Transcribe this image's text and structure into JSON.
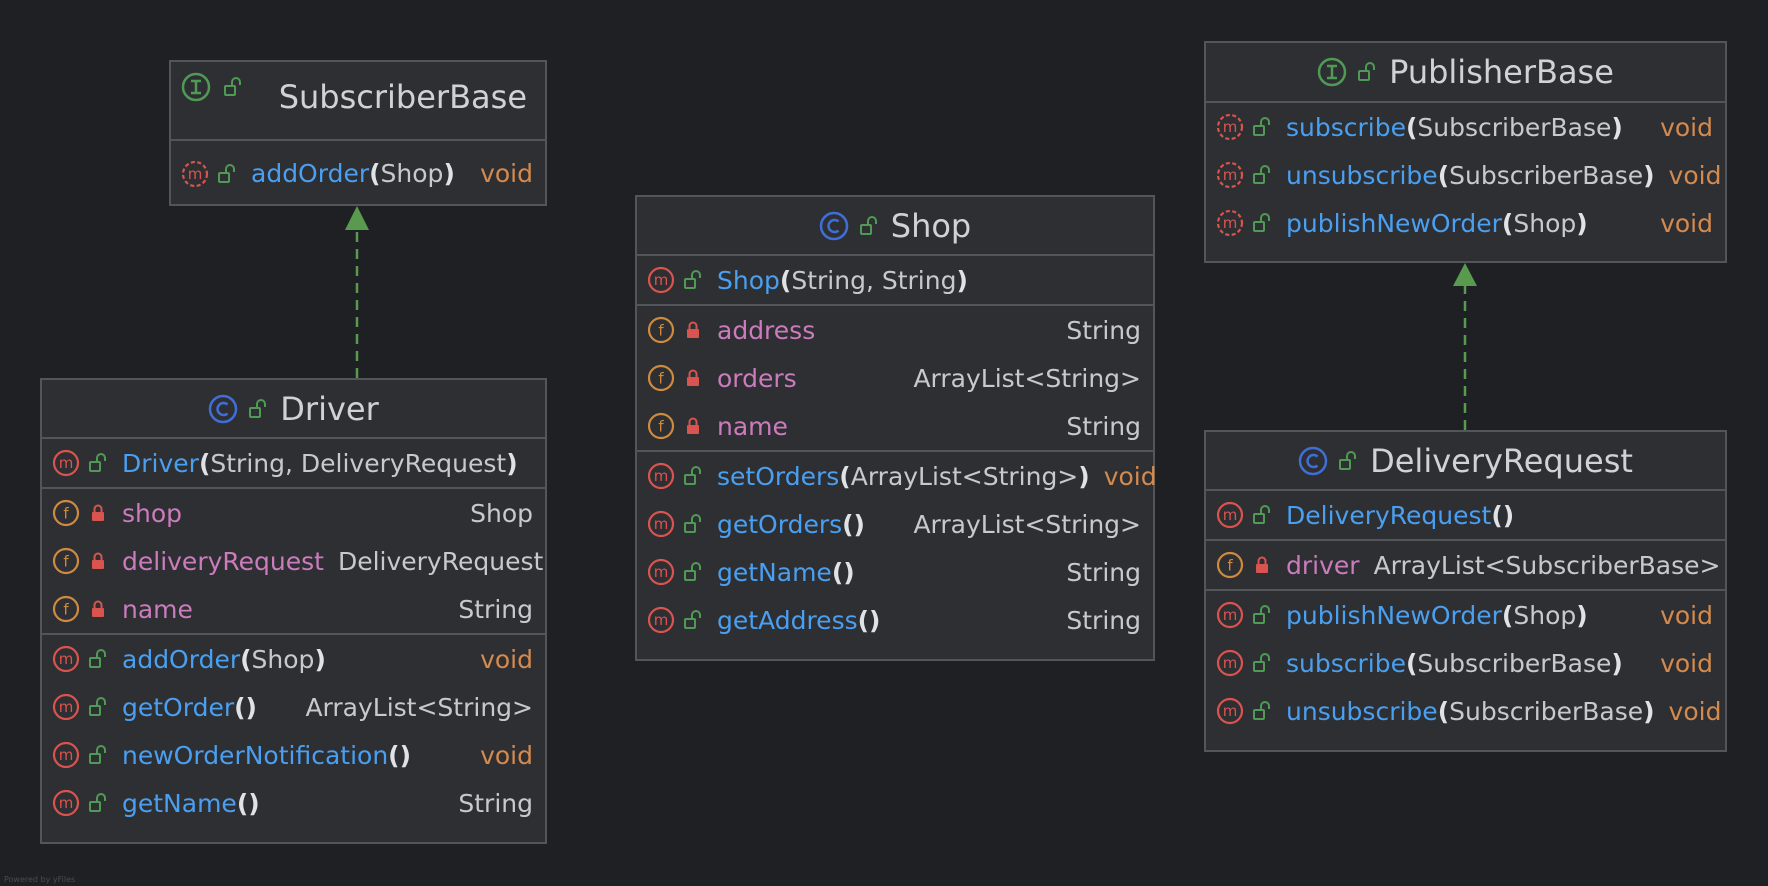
{
  "diagram": {
    "footer": "Powered by yFiles",
    "classes": {
      "subscriber_base": {
        "name": "SubscriberBase",
        "kind": "interface",
        "methods": [
          {
            "name": "addOrder",
            "params": "Shop",
            "ret": "void",
            "abstract": true
          }
        ]
      },
      "publisher_base": {
        "name": "PublisherBase",
        "kind": "interface",
        "methods": [
          {
            "name": "subscribe",
            "params": "SubscriberBase",
            "ret": "void",
            "abstract": true
          },
          {
            "name": "unsubscribe",
            "params": "SubscriberBase",
            "ret": "void",
            "abstract": true
          },
          {
            "name": "publishNewOrder",
            "params": "Shop",
            "ret": "void",
            "abstract": true
          }
        ]
      },
      "shop": {
        "name": "Shop",
        "kind": "class",
        "constructor": {
          "name": "Shop",
          "params": "String, String"
        },
        "fields": [
          {
            "name": "address",
            "type": "String"
          },
          {
            "name": "orders",
            "type": "ArrayList<String>"
          },
          {
            "name": "name",
            "type": "String"
          }
        ],
        "methods": [
          {
            "name": "setOrders",
            "params": "ArrayList<String>",
            "ret": "void"
          },
          {
            "name": "getOrders",
            "params": "",
            "ret": "ArrayList<String>"
          },
          {
            "name": "getName",
            "params": "",
            "ret": "String"
          },
          {
            "name": "getAddress",
            "params": "",
            "ret": "String"
          }
        ]
      },
      "driver": {
        "name": "Driver",
        "kind": "class",
        "constructor": {
          "name": "Driver",
          "params": "String, DeliveryRequest"
        },
        "fields": [
          {
            "name": "shop",
            "type": "Shop"
          },
          {
            "name": "deliveryRequest",
            "type": "DeliveryRequest"
          },
          {
            "name": "name",
            "type": "String"
          }
        ],
        "methods": [
          {
            "name": "addOrder",
            "params": "Shop",
            "ret": "void"
          },
          {
            "name": "getOrder",
            "params": "",
            "ret": "ArrayList<String>"
          },
          {
            "name": "newOrderNotification",
            "params": "",
            "ret": "void"
          },
          {
            "name": "getName",
            "params": "",
            "ret": "String"
          }
        ]
      },
      "delivery_request": {
        "name": "DeliveryRequest",
        "kind": "class",
        "constructor": {
          "name": "DeliveryRequest",
          "params": ""
        },
        "fields": [
          {
            "name": "driver",
            "type": "ArrayList<SubscriberBase>"
          }
        ],
        "methods": [
          {
            "name": "publishNewOrder",
            "params": "Shop",
            "ret": "void"
          },
          {
            "name": "subscribe",
            "params": "SubscriberBase",
            "ret": "void"
          },
          {
            "name": "unsubscribe",
            "params": "SubscriberBase",
            "ret": "void"
          }
        ]
      }
    },
    "relations": [
      {
        "from": "driver",
        "to": "subscriber_base",
        "type": "implements"
      },
      {
        "from": "delivery_request",
        "to": "publisher_base",
        "type": "implements"
      }
    ],
    "colors": {
      "background": "#1f2023",
      "box": "#2d2f33",
      "border": "#52555a",
      "method_name": "#4a9ff0",
      "field_name": "#cc7bbd",
      "void_type": "#d48a4e",
      "arrow": "#5a9a4f"
    },
    "icons": {
      "interface": "interface-icon",
      "class": "class-icon",
      "method": "method-icon",
      "field": "field-icon",
      "public": "public-lock-icon",
      "private": "private-lock-icon"
    }
  }
}
